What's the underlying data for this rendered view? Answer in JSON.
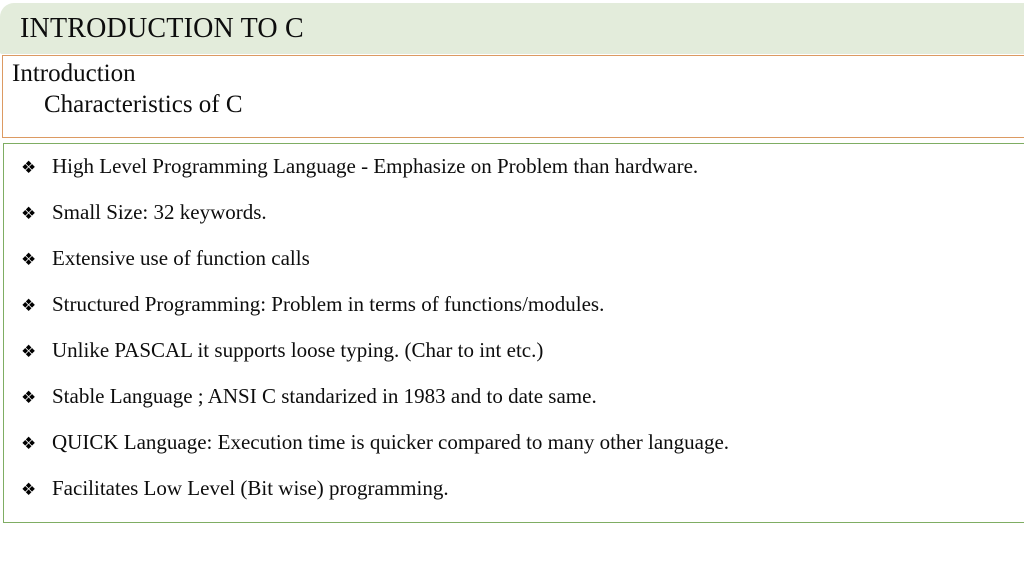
{
  "slide": {
    "title": "INTRODUCTION TO C",
    "outline": {
      "level1": "Introduction",
      "level2": "Characteristics of C"
    },
    "bullet_marker": "❖",
    "bullet_marker_name": "diamond-bullet-icon",
    "bullets": [
      "High Level Programming Language - Emphasize on Problem than hardware.",
      "Small Size: 32 keywords.",
      "Extensive use of function calls",
      "Structured Programming: Problem in terms of functions/modules.",
      "Unlike PASCAL it supports loose typing. (Char to int etc.)",
      "Stable Language ; ANSI C standarized in 1983 and to date same.",
      "QUICK Language: Execution time is quicker compared to many other language.",
      "Facilitates Low Level (Bit wise) programming."
    ],
    "colors": {
      "title_banner_background": "#e3ecdb",
      "subtitle_box_border": "#dc9a62",
      "body_box_border": "#7fad63",
      "text": "#0d0d0d",
      "page_background": "#ffffff"
    }
  }
}
